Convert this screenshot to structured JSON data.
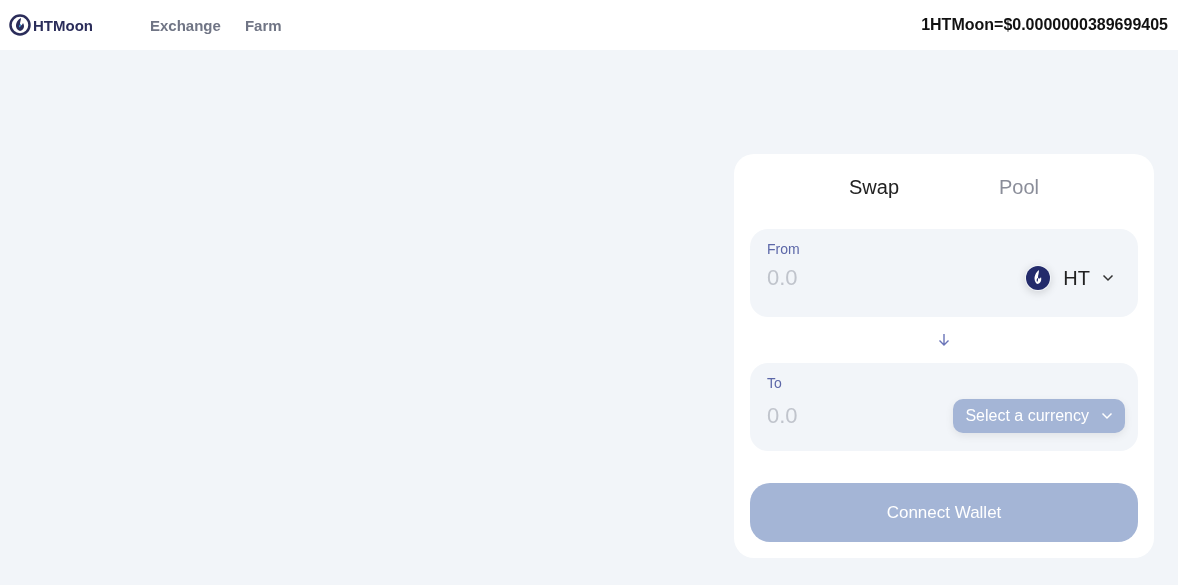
{
  "header": {
    "logo": "HTMoon",
    "nav": [
      {
        "label": "Exchange",
        "selected": false
      },
      {
        "label": "Farm",
        "selected": false
      }
    ],
    "price": "1HTMoon=$0.0000000389699405"
  },
  "card": {
    "tabs": [
      {
        "label": "Swap",
        "selected": true
      },
      {
        "label": "Pool",
        "selected": false
      }
    ],
    "from": {
      "label": "From",
      "placeholder": "0.0",
      "token": {
        "symbol": "HT",
        "kind": "token"
      }
    },
    "to": {
      "label": "To",
      "placeholder": "0.0",
      "token": {
        "symbol": "Select a currency",
        "kind": "select"
      }
    },
    "connect_button": {
      "label": "Connect Wallet",
      "disabled": true
    }
  }
}
